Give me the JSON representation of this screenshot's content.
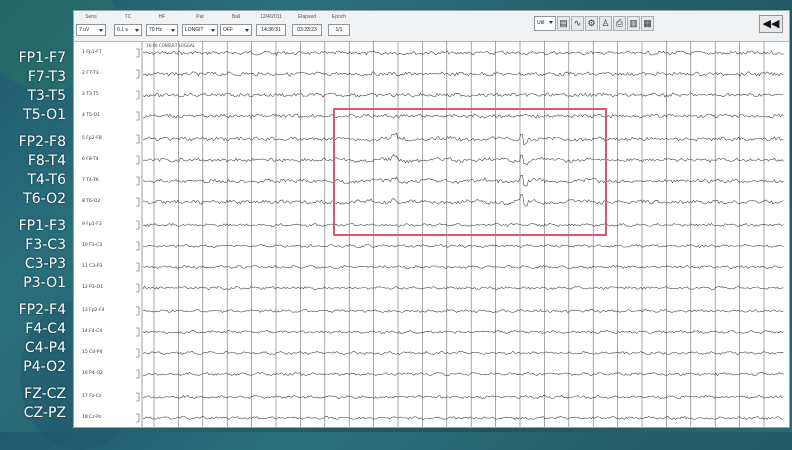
{
  "toolbar": {
    "fields": [
      {
        "header": "Sens",
        "value": "7 uV"
      },
      {
        "header": "TC",
        "value": "0.1 s"
      },
      {
        "header": "HF",
        "value": "70 Hz"
      },
      {
        "header": "Pat",
        "value": "LONGIT"
      },
      {
        "header": "Ball",
        "value": "OFF"
      },
      {
        "header": "12/4/2011",
        "value": "14:36:31"
      },
      {
        "header": "Elapsed",
        "value": "03:23:23"
      },
      {
        "header": "Epoch",
        "value": "1/1"
      }
    ],
    "select_value": "Util",
    "nav_label": "◀◀"
  },
  "annotation": "16:00 CONSULT LOGGAL",
  "montage_labels": [
    "FP1-F7",
    "F7-T3",
    "T3-T5",
    "T5-O1",
    "FP2-F8",
    "F8-T4",
    "T4-T6",
    "T6-O2",
    "FP1-F3",
    "F3-C3",
    "C3-P3",
    "P3-O1",
    "FP2-F4",
    "F4-C4",
    "C4-P4",
    "P4-O2",
    "FZ-CZ",
    "CZ-PZ"
  ],
  "channel_names": [
    "1 Fp1-F7",
    "2 F7-T3",
    "3 T3-T5",
    "4 T5-O1",
    "5 Fp2-F8",
    "6 F8-T4",
    "7 T4-T6",
    "8 T6-O2",
    "9 Fp1-F3",
    "10 F3-C3",
    "11 C3-P3",
    "12 P3-O1",
    "13 Fp2-F4",
    "14 F4-C4",
    "15 C4-P4",
    "16 P4-O2",
    "17 Fz-Cz",
    "18 Cz-Pz"
  ],
  "colors": {
    "highlight": "#e0566a",
    "trace": "#3a3a3a",
    "grid": "#6e6e6e"
  }
}
